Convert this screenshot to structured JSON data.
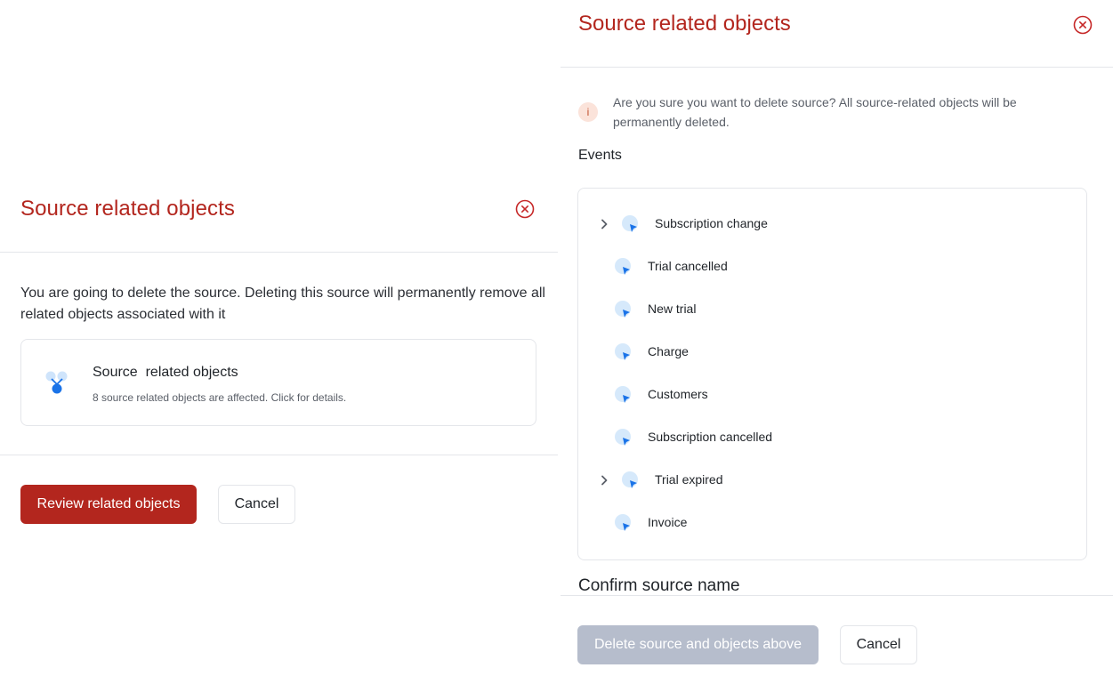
{
  "left_modal": {
    "title": "Source related objects",
    "description": "You are going to delete the source. Deleting this source will permanently remove all related objects associated with it",
    "card": {
      "title": "Source  related objects",
      "subtitle": "8 source related objects are affected. Click for details.",
      "icon": "source-objects-icon"
    },
    "primary_button": "Review related objects",
    "cancel_button": "Cancel"
  },
  "right_modal": {
    "title": "Source related objects",
    "notice": "Are you sure you want to delete source? All source-related objects will be permanently deleted.",
    "info_icon_glyph": "i",
    "events_label": "Events",
    "events": [
      {
        "label": "Subscription change",
        "expandable": true
      },
      {
        "label": "Trial cancelled",
        "expandable": false
      },
      {
        "label": "New trial",
        "expandable": false
      },
      {
        "label": "Charge",
        "expandable": false
      },
      {
        "label": "Customers",
        "expandable": false
      },
      {
        "label": "Subscription cancelled",
        "expandable": false
      },
      {
        "label": "Trial expired",
        "expandable": true
      },
      {
        "label": "Invoice",
        "expandable": false
      }
    ],
    "confirm_label": "Confirm source name",
    "delete_button": "Delete source and objects above",
    "cancel_button": "Cancel"
  },
  "colors": {
    "accent_red": "#b3261e",
    "disabled_button": "#b6bdcc",
    "event_icon_light": "#d6e9fb",
    "event_icon_dark": "#1a73e8",
    "info_bg": "#fbe3da"
  }
}
